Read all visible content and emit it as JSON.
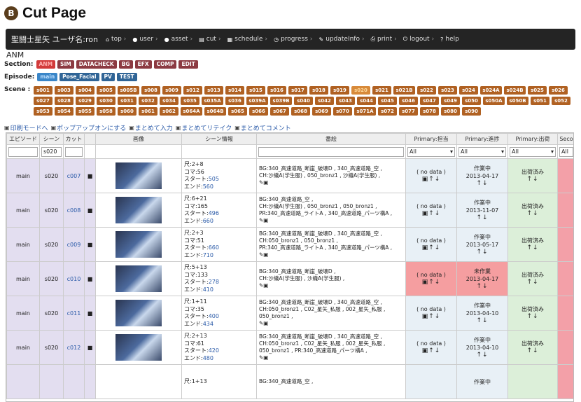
{
  "header": {
    "badge": "B",
    "title": "Cut Page"
  },
  "nav": {
    "brand": "聖闘士星矢 ユーザ名:ron",
    "items": [
      {
        "icon": "⌂",
        "label": "top",
        "name": "top"
      },
      {
        "icon": "●",
        "label": "user",
        "name": "user"
      },
      {
        "icon": "●",
        "label": "asset",
        "name": "asset"
      },
      {
        "icon": "▤",
        "label": "cut",
        "name": "cut"
      },
      {
        "icon": "▦",
        "label": "schedule",
        "name": "schedule"
      },
      {
        "icon": "◷",
        "label": "progress",
        "name": "progress"
      },
      {
        "icon": "✎",
        "label": "updateInfo",
        "name": "updateinfo"
      },
      {
        "icon": "⎙",
        "label": "print",
        "name": "print"
      },
      {
        "icon": "⏻",
        "label": "logout",
        "name": "logout"
      },
      {
        "icon": "?",
        "label": "help",
        "name": "help"
      }
    ]
  },
  "project": "ANM",
  "section": {
    "label": "Section:",
    "items": [
      "ANM",
      "SIM",
      "DATACHECK",
      "BG",
      "EFX",
      "COMP",
      "EDIT"
    ]
  },
  "episode": {
    "label": "Episode:",
    "items": [
      "main",
      "Pose_Facial",
      "PV",
      "TEST"
    ]
  },
  "scene": {
    "label": "Scene :",
    "items": [
      "s001",
      "s003",
      "s004",
      "s005",
      "s005B",
      "s008",
      "s009",
      "s012",
      "s013",
      "s014",
      "s015",
      "s016",
      "s017",
      "s018",
      "s019",
      "s020",
      "s021",
      "s021B",
      "s022",
      "s023",
      "s024",
      "s024A",
      "s024B",
      "s025",
      "s026",
      "s027",
      "s028",
      "s029",
      "s030",
      "s031",
      "s032",
      "s034",
      "s035",
      "s035A",
      "s036",
      "s039A",
      "s039B",
      "s040",
      "s042",
      "s043",
      "s044",
      "s045",
      "s046",
      "s047",
      "s049",
      "s050",
      "s050A",
      "s050B",
      "s051",
      "s052",
      "s053",
      "s054",
      "s055",
      "s058",
      "s060",
      "s061",
      "s062",
      "s064A",
      "s064B",
      "s065",
      "s066",
      "s067",
      "s068",
      "s069",
      "s070",
      "s071A",
      "s072",
      "s077",
      "s078",
      "s080",
      "s090"
    ]
  },
  "links": [
    "印刷モードへ",
    "ポップアップオンにする",
    "まとめて入力",
    "まとめてリテイク",
    "まとめてコメント"
  ],
  "table": {
    "headers": [
      "エピソード",
      "シーン",
      "カット",
      "",
      "画像",
      "シーン情報",
      "番絵",
      "Primary:担当",
      "Primary:進捗",
      "Primary:出荷",
      "Seco"
    ],
    "filters": {
      "scene": "s020",
      "primary_assign": "All",
      "primary_progress": "All",
      "primary_ship": "All",
      "secondary": "All"
    },
    "rows": [
      {
        "ep": "main",
        "scene": "s020",
        "cut": "c007",
        "size": "尺:2+8",
        "frames": "コマ:56",
        "start": "505",
        "end": "560",
        "bg": "BG:340_高速道路_断崖_破壊D , 340_高速道路_空 ,",
        "ch": "CH:沙織A(学生服) , 050_bronz1 , 沙織A(学生服) ,",
        "pr": "",
        "assign": "( no data )",
        "prog": "作業中",
        "pdate": "2013-04-17",
        "ship": "出荷済み",
        "red": false
      },
      {
        "ep": "main",
        "scene": "s020",
        "cut": "c008",
        "size": "尺:6+21",
        "frames": "コマ:165",
        "start": "496",
        "end": "660",
        "bg": "BG:340_高速道路_空 ,",
        "ch": "CH:沙織A(学生服) , 050_bronz1 , 050_bronz1 ,",
        "pr": "PR:340_高速道路_ライトA , 340_高速道路_パーツ構A ,",
        "assign": "( no data )",
        "prog": "作業中",
        "pdate": "2013-11-07",
        "ship": "出荷済み",
        "red": false
      },
      {
        "ep": "main",
        "scene": "s020",
        "cut": "c009",
        "size": "尺:2+3",
        "frames": "コマ:51",
        "start": "660",
        "end": "710",
        "bg": "BG:340_高速道路_断崖_破壊D , 340_高速道路_空 ,",
        "ch": "CH:050_bronz1 , 050_bronz1 ,",
        "pr": "PR:340_高速道路_ライトA , 340_高速道路_パーツ構A ,",
        "assign": "( no data )",
        "prog": "作業中",
        "pdate": "2013-05-17",
        "ship": "出荷済み",
        "red": false
      },
      {
        "ep": "main",
        "scene": "s020",
        "cut": "c010",
        "size": "尺:5+13",
        "frames": "コマ:133",
        "start": "278",
        "end": "410",
        "bg": "BG:340_高速道路_断崖_破壊D ,",
        "ch": "CH:沙織A(学生服) , 沙織A(学生服) ,",
        "pr": "",
        "assign": "( no data )",
        "prog": "未作業",
        "pdate": "2013-04-17",
        "ship": "出荷済み",
        "red": true
      },
      {
        "ep": "main",
        "scene": "s020",
        "cut": "c011",
        "size": "尺:1+11",
        "frames": "コマ:35",
        "start": "400",
        "end": "434",
        "bg": "BG:340_高速道路_断崖_破壊D , 340_高速道路_空 ,",
        "ch": "CH:050_bronz1 , C02_星矢_私服 , 002_星矢_私服 ,",
        "pr": "050_bronz1 ,",
        "assign": "( no data )",
        "prog": "作業中",
        "pdate": "2013-04-10",
        "ship": "出荷済み",
        "red": false
      },
      {
        "ep": "main",
        "scene": "s020",
        "cut": "c012",
        "size": "尺:2+13",
        "frames": "コマ:61",
        "start": "420",
        "end": "480",
        "bg": "BG:340_高速道路_断崖_破壊D , 340_高速道路_空 ,",
        "ch": "CH:050_bronz1 , C02_星矢_私服 , 002_星矢_私服 ,",
        "pr": "050_bronz1 ,  PR:340_高速道路_パーツ構A ,",
        "assign": "( no data )",
        "prog": "作業中",
        "pdate": "2013-04-10",
        "ship": "出荷済み",
        "red": false
      },
      {
        "ep": "",
        "scene": "",
        "cut": "",
        "size": "尺:1+13",
        "frames": "",
        "start": "",
        "end": "",
        "bg": "BG:340_高速道路_空 ,",
        "ch": "",
        "pr": "",
        "assign": "",
        "prog": "作業中",
        "pdate": "",
        "ship": "",
        "red": false
      }
    ],
    "labels": {
      "start": "スタート:",
      "end": "エンド:",
      "arrows": "↑↓"
    }
  }
}
